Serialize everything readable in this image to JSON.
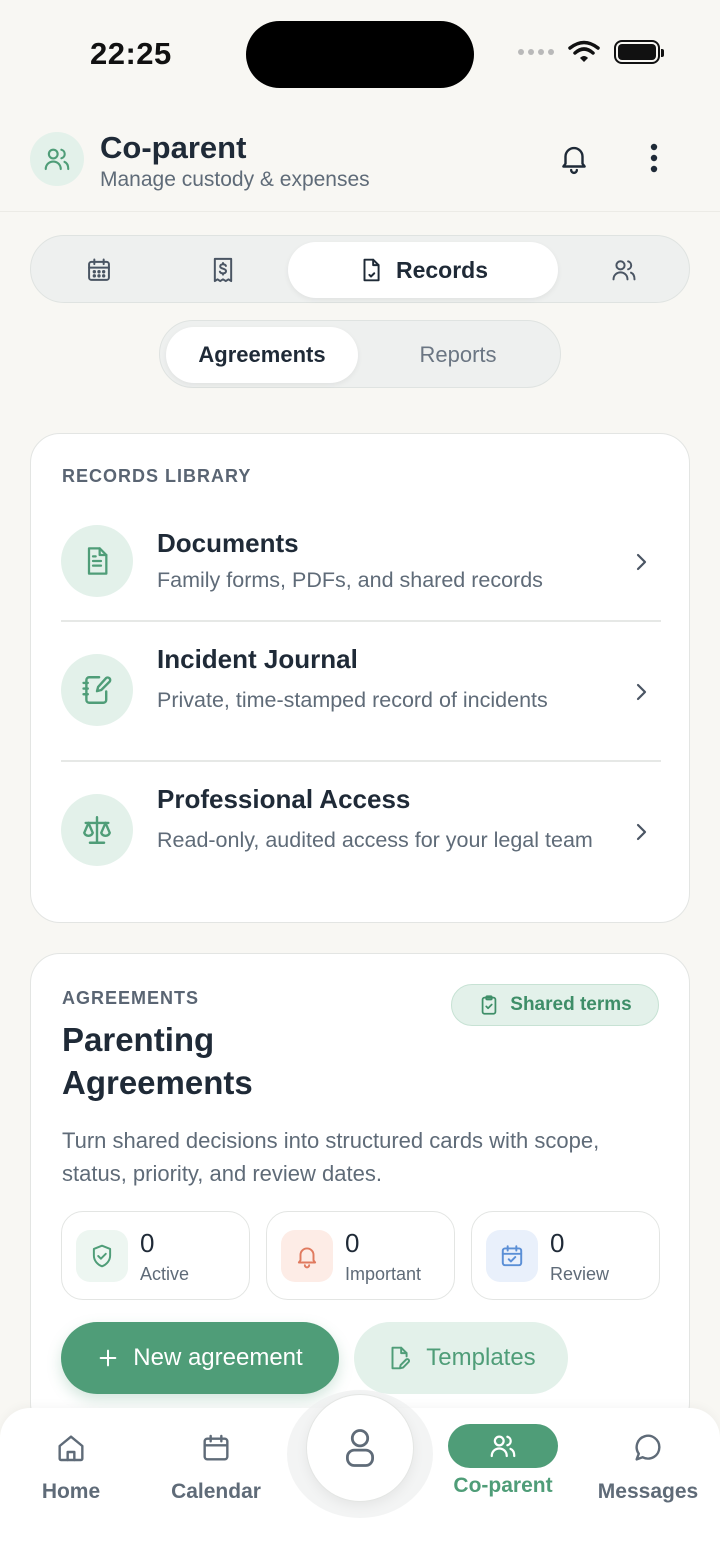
{
  "status_bar": {
    "time": "22:25"
  },
  "header": {
    "title": "Co-parent",
    "subtitle": "Manage custody & expenses"
  },
  "main_tabs": [
    {
      "icon": "calendar-icon",
      "label": ""
    },
    {
      "icon": "receipt-icon",
      "label": ""
    },
    {
      "icon": "document-icon",
      "label": "Records",
      "active": true
    },
    {
      "icon": "users-icon",
      "label": ""
    }
  ],
  "sub_tabs": {
    "agreements": "Agreements",
    "reports": "Reports"
  },
  "records_library": {
    "eyebrow": "RECORDS LIBRARY",
    "items": [
      {
        "icon": "document-icon",
        "title": "Documents",
        "description": "Family forms, PDFs, and shared records"
      },
      {
        "icon": "notebook-pen-icon",
        "title": "Incident Journal",
        "description": "Private, time-stamped record of incidents"
      },
      {
        "icon": "scale-icon",
        "title": "Professional Access",
        "description": "Read-only, audited access for your legal team"
      }
    ]
  },
  "agreements": {
    "eyebrow": "AGREEMENTS",
    "badge": "Shared terms",
    "title": "Parenting Agreements",
    "description": "Turn shared decisions into structured cards with scope, status, priority, and review dates.",
    "stats": [
      {
        "icon": "shield-check-icon",
        "value": "0",
        "label": "Active",
        "color": "#4f9d78"
      },
      {
        "icon": "bell-icon",
        "value": "0",
        "label": "Important",
        "color": "#e07a5f"
      },
      {
        "icon": "calendar-check-icon",
        "value": "0",
        "label": "Review",
        "color": "#5b8fd6"
      }
    ],
    "new_button": "New agreement",
    "templates_button": "Templates"
  },
  "bottom_nav": {
    "home": "Home",
    "calendar": "Calendar",
    "coparent": "Co-parent",
    "messages": "Messages"
  },
  "colors": {
    "accent": "#4f9d78",
    "accent_light": "#e3f1ea",
    "text": "#1f2a37",
    "muted": "#5f6b78",
    "background": "#f8f7f3"
  }
}
